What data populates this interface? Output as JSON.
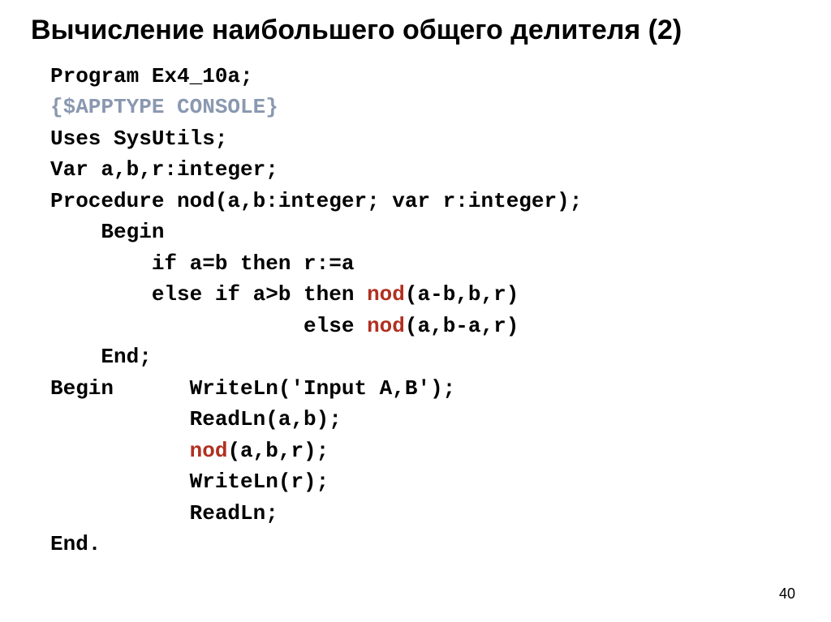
{
  "title": "Вычисление наибольшего общего делителя (2)",
  "page_number": "40",
  "code": {
    "l01": "Program Ex4_10a;",
    "l02": "{$APPTYPE CONSOLE}",
    "l03": "Uses SysUtils;",
    "l04": "Var a,b,r:integer;",
    "l05": "Procedure nod(a,b:integer; var r:integer);",
    "l06": "    Begin",
    "l07": "        if a=b then r:=a",
    "l08a": "        else if a>b then ",
    "l08b": "nod",
    "l08c": "(a-b,b,r)",
    "l09a": "                    else ",
    "l09b": "nod",
    "l09c": "(a,b-a,r)",
    "l10": "    End;",
    "l11": "Begin      WriteLn('Input A,B');",
    "l12": "           ReadLn(a,b);",
    "l13a": "           ",
    "l13b": "nod",
    "l13c": "(a,b,r);",
    "l14": "           WriteLn(r);",
    "l15": "           ReadLn;",
    "l16": "End."
  }
}
